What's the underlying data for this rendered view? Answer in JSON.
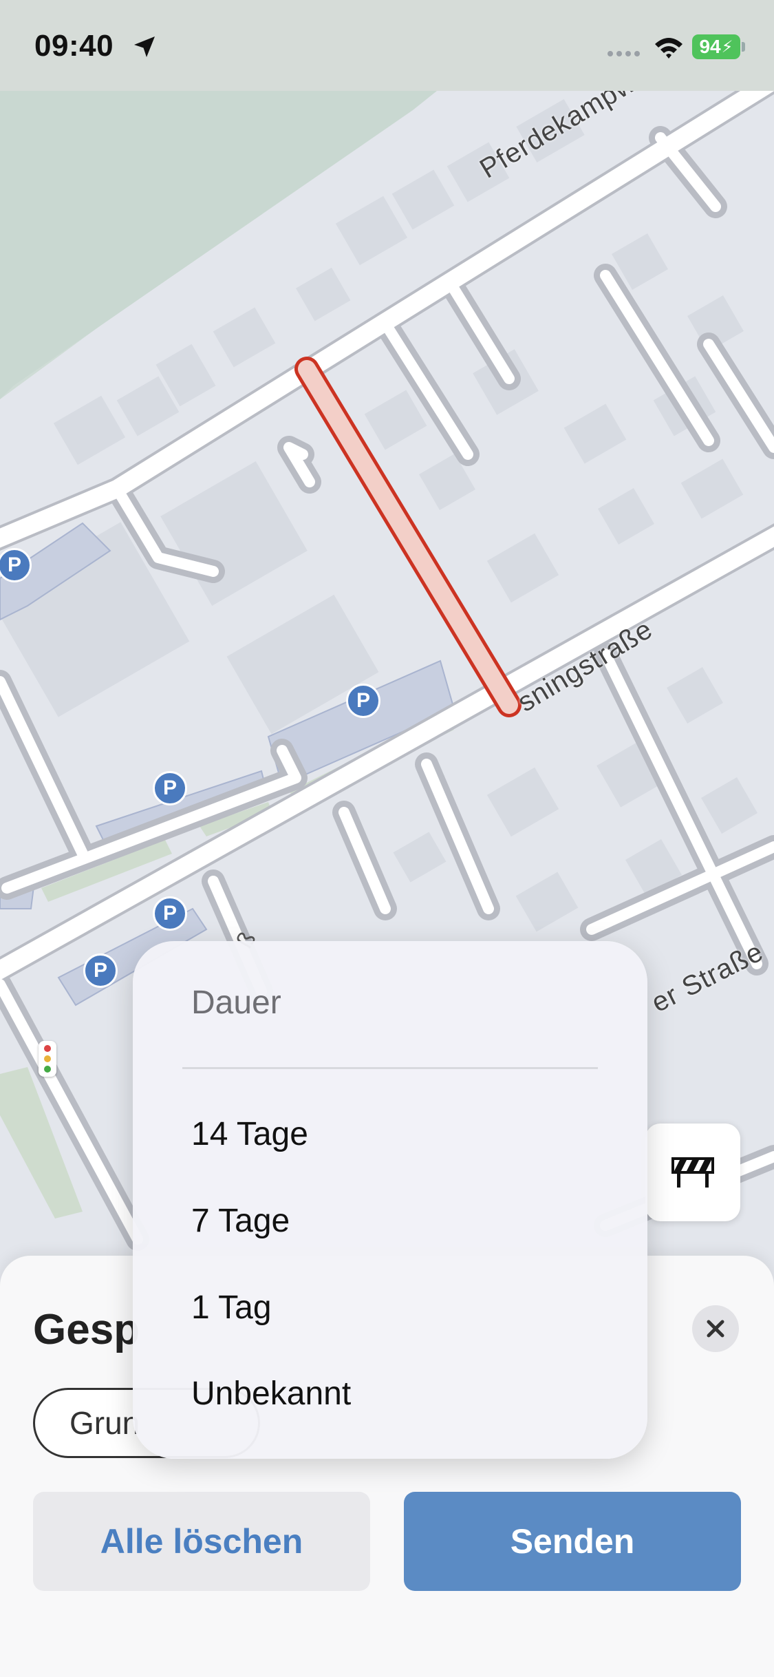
{
  "status_bar": {
    "time": "09:40",
    "battery": "94"
  },
  "map": {
    "street_labels": [
      "Pferdekampweg",
      "sningstraße",
      "er Straße"
    ],
    "parking_symbol": "P",
    "hidden_label_fragment": "ß"
  },
  "sheet": {
    "title": "Gesp",
    "chip_label": "Grun",
    "clear_button": "Alle löschen",
    "send_button": "Senden"
  },
  "menu": {
    "header": "Dauer",
    "items": [
      "14 Tage",
      "7 Tage",
      "1 Tag",
      "Unbekannt"
    ]
  },
  "colors": {
    "accent": "#5b8bc4",
    "accent_text": "#4a7fc1",
    "selection_outline": "#cc3322",
    "selection_fill": "#f3cfc8",
    "parking": "#4a7abe",
    "battery": "#4fc35b"
  }
}
